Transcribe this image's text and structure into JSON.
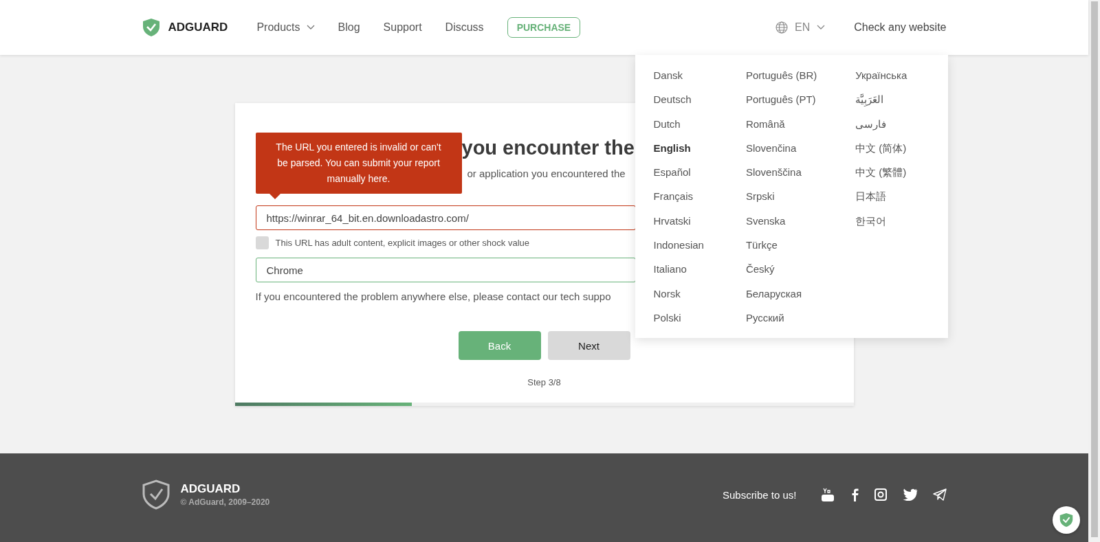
{
  "header": {
    "logo": "ADGUARD",
    "nav": [
      {
        "label": "Products",
        "dropdown": true
      },
      {
        "label": "Blog",
        "dropdown": false
      },
      {
        "label": "Support",
        "dropdown": false
      },
      {
        "label": "Discuss",
        "dropdown": false
      }
    ],
    "purchase": "PURCHASE",
    "language": {
      "code": "EN",
      "expanded": true
    },
    "check_link": "Check any website"
  },
  "language_menu": {
    "columns": [
      [
        {
          "label": "Dansk",
          "selected": false
        },
        {
          "label": "Deutsch",
          "selected": false
        },
        {
          "label": "Dutch",
          "selected": false
        },
        {
          "label": "English",
          "selected": true
        },
        {
          "label": "Español",
          "selected": false
        },
        {
          "label": "Français",
          "selected": false
        },
        {
          "label": "Hrvatski",
          "selected": false
        },
        {
          "label": "Indonesian",
          "selected": false
        },
        {
          "label": "Italiano",
          "selected": false
        },
        {
          "label": "Norsk",
          "selected": false
        },
        {
          "label": "Polski",
          "selected": false
        }
      ],
      [
        {
          "label": "Português (BR)",
          "selected": false
        },
        {
          "label": "Português (PT)",
          "selected": false
        },
        {
          "label": "Română",
          "selected": false
        },
        {
          "label": "Slovenčina",
          "selected": false
        },
        {
          "label": "Slovenščina",
          "selected": false
        },
        {
          "label": "Srpski",
          "selected": false
        },
        {
          "label": "Svenska",
          "selected": false
        },
        {
          "label": "Türkçe",
          "selected": false
        },
        {
          "label": "Český",
          "selected": false
        },
        {
          "label": "Беларуская",
          "selected": false
        },
        {
          "label": "Русский",
          "selected": false
        }
      ],
      [
        {
          "label": "Українська",
          "selected": false
        },
        {
          "label": "العَرَبِيَّة",
          "selected": false
        },
        {
          "label": "فارسی",
          "selected": false
        },
        {
          "label": "中文 (简体)",
          "selected": false
        },
        {
          "label": "中文 (繁體)",
          "selected": false
        },
        {
          "label": "日本語",
          "selected": false
        },
        {
          "label": "한국어",
          "selected": false
        }
      ]
    ]
  },
  "form": {
    "title_visible": "you encounter the",
    "subtitle_visible": "or application you encountered the",
    "tooltip": "The URL you entered is invalid or can't be parsed. You can submit your report manually here.",
    "url_field": {
      "value": "https://winrar_64_bit.en.downloadastro.com/",
      "invalid": true
    },
    "adult_checkbox": {
      "label": "This URL has adult content, explicit images or other shock value",
      "checked": false
    },
    "app_field": {
      "value": "Chrome",
      "valid": true
    },
    "note": "If you encountered the problem anywhere else, please contact our tech suppo",
    "buttons": [
      {
        "label": "Back",
        "kind": "primary"
      },
      {
        "label": "Next",
        "kind": "secondary"
      }
    ],
    "step": "Step 3/8",
    "progress": {
      "level": 0.286
    }
  },
  "footer": {
    "logo": "ADGUARD",
    "copyright": "© AdGuard, 2009–2020",
    "subscribe": "Subscribe to us!"
  }
}
